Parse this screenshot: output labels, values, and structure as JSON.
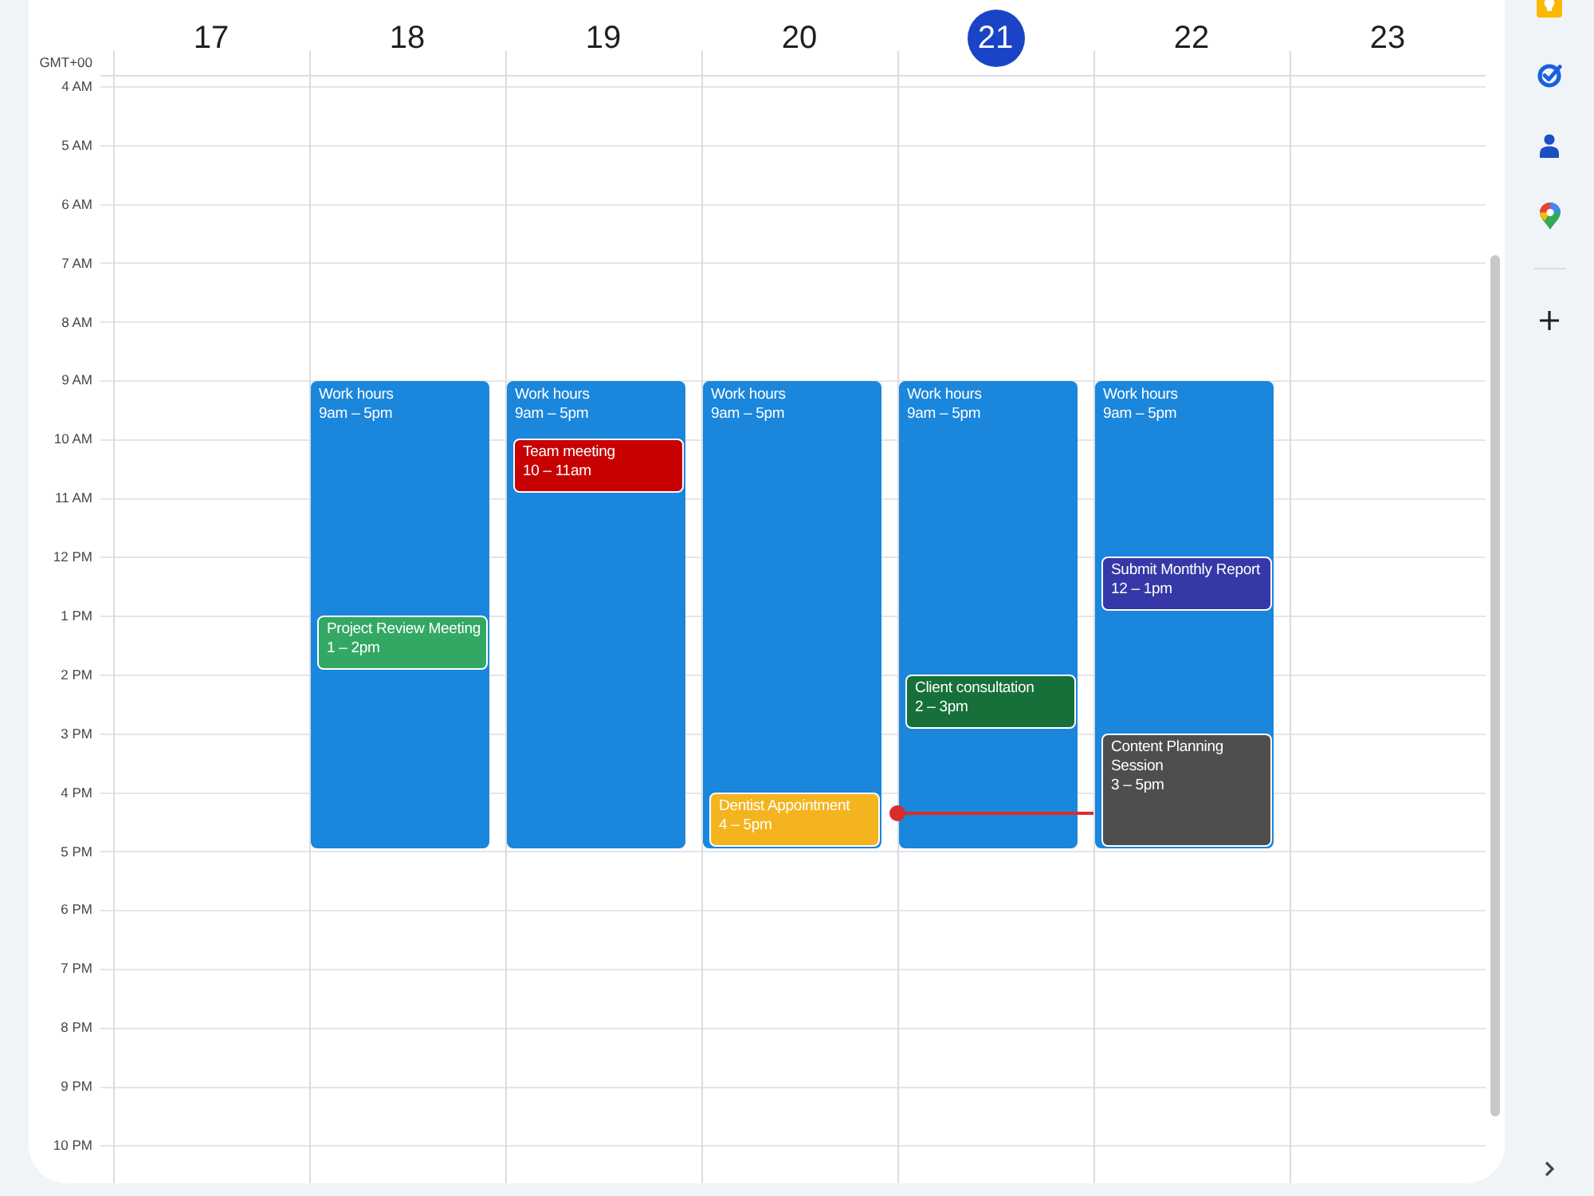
{
  "timezone": "GMT+00",
  "hours": [
    {
      "label": "4 AM",
      "now": false
    },
    {
      "label": "5 AM",
      "now": false
    },
    {
      "label": "6 AM",
      "now": false
    },
    {
      "label": "7 AM",
      "now": false
    },
    {
      "label": "8 AM",
      "now": false
    },
    {
      "label": "9 AM",
      "now": false
    },
    {
      "label": "10 AM",
      "now": false
    },
    {
      "label": "11 AM",
      "now": false
    },
    {
      "label": "12 PM",
      "now": false
    },
    {
      "label": "1 PM",
      "now": false
    },
    {
      "label": "2 PM",
      "now": false
    },
    {
      "label": "3 PM",
      "now": false
    },
    {
      "label": "4 PM",
      "now": true
    },
    {
      "label": "5 PM",
      "now": false
    },
    {
      "label": "6 PM",
      "now": false
    },
    {
      "label": "7 PM",
      "now": false
    },
    {
      "label": "8 PM",
      "now": false
    },
    {
      "label": "9 PM",
      "now": false
    },
    {
      "label": "10 PM",
      "now": false
    }
  ],
  "days": [
    {
      "date": "17",
      "selected": false
    },
    {
      "date": "18",
      "selected": false,
      "events": [
        {
          "kind": "work",
          "title": "Work hours",
          "time": "9am – 5pm",
          "color": "#1a86dc"
        },
        {
          "kind": "event",
          "title": "Project Review Meeting",
          "time": "1 – 2pm",
          "color": "#33a865"
        }
      ]
    },
    {
      "date": "19",
      "selected": false,
      "events": [
        {
          "kind": "work",
          "title": "Work hours",
          "time": "9am – 5pm",
          "color": "#1a86dc"
        },
        {
          "kind": "event",
          "title": "Team meeting",
          "time": "10 – 11am",
          "color": "#c70000"
        }
      ]
    },
    {
      "date": "20",
      "selected": false,
      "events": [
        {
          "kind": "work",
          "title": "Work hours",
          "time": "9am – 5pm",
          "color": "#1a86dc"
        },
        {
          "kind": "event",
          "title": "Dentist Appointment",
          "time": "4 – 5pm",
          "color": "#f4b41f"
        }
      ]
    },
    {
      "date": "21",
      "selected": true,
      "events": [
        {
          "kind": "work",
          "title": "Work hours",
          "time": "9am – 5pm",
          "color": "#1a86dc"
        },
        {
          "kind": "event",
          "title": "Client consultation",
          "time": "2 – 3pm",
          "color": "#17703a"
        }
      ]
    },
    {
      "date": "22",
      "selected": false,
      "events": [
        {
          "kind": "work",
          "title": "Work hours",
          "time": "9am – 5pm",
          "color": "#1a86dc"
        },
        {
          "kind": "event",
          "title": "Submit Monthly Report",
          "time": "12 – 1pm",
          "color": "#3538a6"
        },
        {
          "kind": "event",
          "title": "Content Planning Session",
          "time": "3 – 5pm",
          "color": "#4e4e4e"
        }
      ]
    },
    {
      "date": "23",
      "selected": false
    }
  ]
}
